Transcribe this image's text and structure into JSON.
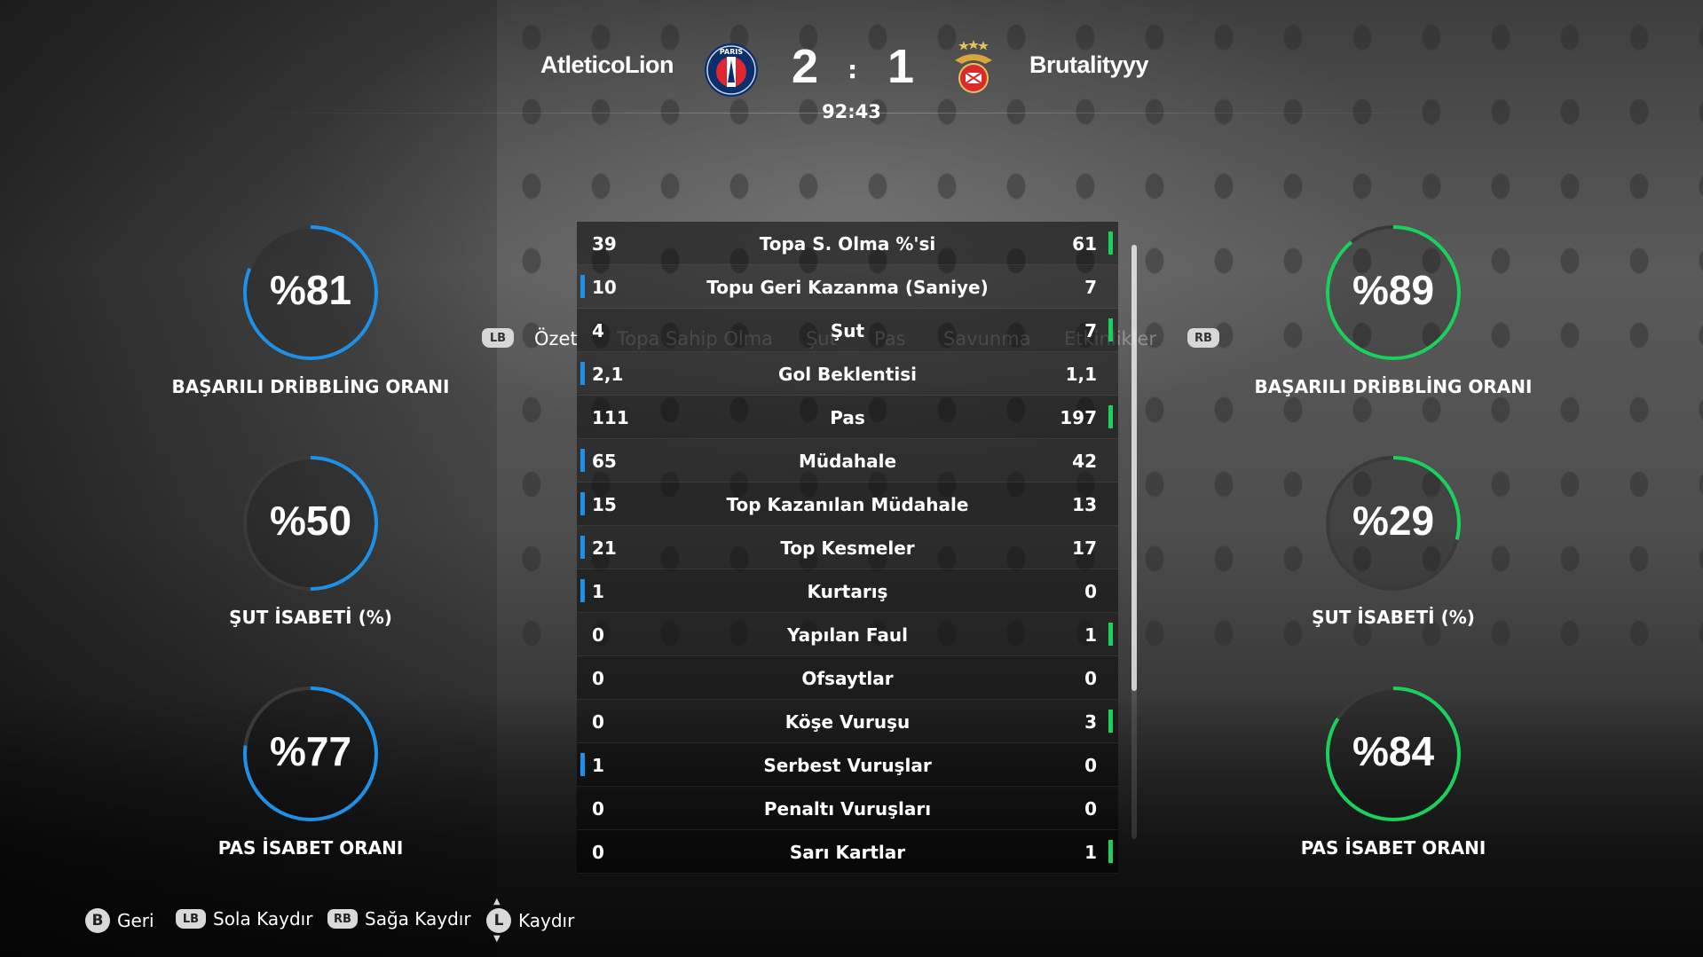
{
  "header": {
    "home_team": "AtleticoLion",
    "away_team": "Brutalityyy",
    "home_score": "2",
    "away_score": "1",
    "separator": ":",
    "clock": "92:43",
    "home_crest_icon": "psg-crest-icon",
    "away_crest_icon": "benfica-crest-icon"
  },
  "tabs": {
    "left_shoulder": "LB",
    "right_shoulder": "RB",
    "items": [
      "Özet",
      "Topa Sahip Olma",
      "Şut",
      "Pas",
      "Savunma",
      "Etkinlikler"
    ],
    "active": "Özet"
  },
  "stats": [
    {
      "label": "Topa S. Olma %'si",
      "home": "39",
      "away": "61",
      "leader": "away"
    },
    {
      "label": "Topu Geri Kazanma (Saniye)",
      "home": "10",
      "away": "7",
      "leader": "home"
    },
    {
      "label": "Şut",
      "home": "4",
      "away": "7",
      "leader": "away"
    },
    {
      "label": "Gol Beklentisi",
      "home": "2,1",
      "away": "1,1",
      "leader": "home"
    },
    {
      "label": "Pas",
      "home": "111",
      "away": "197",
      "leader": "away"
    },
    {
      "label": "Müdahale",
      "home": "65",
      "away": "42",
      "leader": "home"
    },
    {
      "label": "Top Kazanılan Müdahale",
      "home": "15",
      "away": "13",
      "leader": "home"
    },
    {
      "label": "Top Kesmeler",
      "home": "21",
      "away": "17",
      "leader": "home"
    },
    {
      "label": "Kurtarış",
      "home": "1",
      "away": "0",
      "leader": "home"
    },
    {
      "label": "Yapılan Faul",
      "home": "0",
      "away": "1",
      "leader": "away"
    },
    {
      "label": "Ofsaytlar",
      "home": "0",
      "away": "0",
      "leader": "none"
    },
    {
      "label": "Köşe Vuruşu",
      "home": "0",
      "away": "3",
      "leader": "away"
    },
    {
      "label": "Serbest Vuruşlar",
      "home": "1",
      "away": "0",
      "leader": "home"
    },
    {
      "label": "Penaltı Vuruşları",
      "home": "0",
      "away": "0",
      "leader": "none"
    },
    {
      "label": "Sarı Kartlar",
      "home": "0",
      "away": "1",
      "leader": "away"
    }
  ],
  "gauges": {
    "home": [
      {
        "value_text": "%81",
        "percent": 81,
        "label": "BAŞARILI DRİBBLİNG ORANI"
      },
      {
        "value_text": "%50",
        "percent": 50,
        "label": "ŞUT İSABETİ (%)"
      },
      {
        "value_text": "%77",
        "percent": 77,
        "label": "PAS İSABET ORANI"
      }
    ],
    "away": [
      {
        "value_text": "%89",
        "percent": 89,
        "label": "BAŞARILI DRİBBLİNG ORANI"
      },
      {
        "value_text": "%29",
        "percent": 29,
        "label": "ŞUT İSABETİ (%)"
      },
      {
        "value_text": "%84",
        "percent": 84,
        "label": "PAS İSABET ORANI"
      }
    ]
  },
  "colors": {
    "home_accent": "#1e90e8",
    "away_accent": "#19d25c",
    "gauge_track": "#3a3a3a"
  },
  "footer": {
    "back": {
      "button": "B",
      "label": "Geri"
    },
    "scroll_left": {
      "button": "LB",
      "label": "Sola Kaydır"
    },
    "scroll_right": {
      "button": "RB",
      "label": "Sağa Kaydır"
    },
    "scroll": {
      "button": "L",
      "label": "Kaydır"
    }
  },
  "scroll": {
    "position": 0,
    "visible_fraction": 0.75
  }
}
